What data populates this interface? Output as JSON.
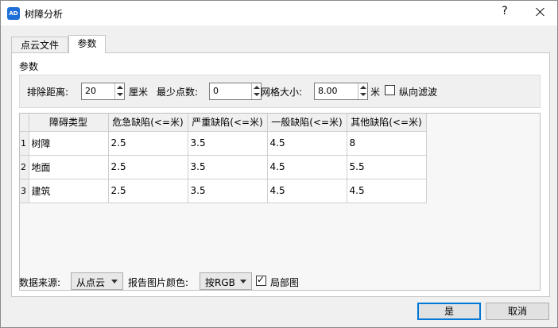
{
  "window": {
    "title": "树障分析",
    "app_icon": "AD",
    "help_label": "?"
  },
  "tabs": [
    {
      "label": "点云文件"
    },
    {
      "label": "参数"
    }
  ],
  "params": {
    "group_label": "参数",
    "exclude_distance_label": "排除距离:",
    "exclude_distance_value": "20",
    "exclude_distance_unit": "厘米",
    "min_points_label": "最少点数:",
    "min_points_value": "0",
    "grid_size_label": "网格大小:",
    "grid_size_value": "8.00",
    "grid_size_unit": "米",
    "vertical_filter_label": "纵向滤波",
    "vertical_filter_checked": false
  },
  "table": {
    "headers": [
      "障碍类型",
      "危急缺陷(<=米)",
      "严重缺陷(<=米)",
      "一般缺陷(<=米)",
      "其他缺陷(<=米)"
    ],
    "rows": [
      {
        "num": "1",
        "cells": [
          "树障",
          "2.5",
          "3.5",
          "4.5",
          "8"
        ]
      },
      {
        "num": "2",
        "cells": [
          "地面",
          "2.5",
          "3.5",
          "4.5",
          "5.5"
        ]
      },
      {
        "num": "3",
        "cells": [
          "建筑",
          "2.5",
          "3.5",
          "4.5",
          "4.5"
        ]
      }
    ]
  },
  "bottom": {
    "source_label": "数据来源:",
    "source_value": "从点云",
    "color_label": "报告图片颜色:",
    "color_value": "按RGB",
    "local_map_label": "局部图",
    "local_map_checked": true
  },
  "buttons": {
    "ok": "是",
    "cancel": "取消"
  }
}
